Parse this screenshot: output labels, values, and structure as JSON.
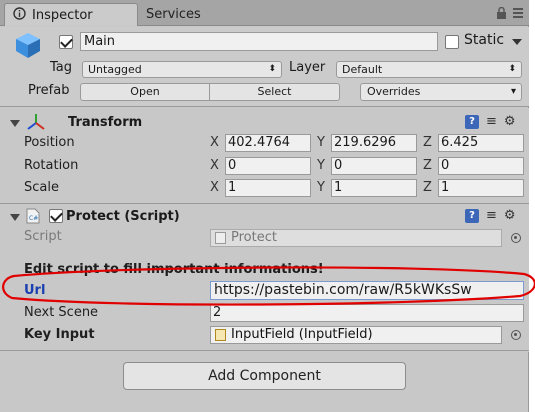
{
  "tabs": [
    {
      "label": "Inspector",
      "active": true
    },
    {
      "label": "Services",
      "active": false
    }
  ],
  "header": {
    "active_checked": true,
    "name_value": "Main",
    "static_label": "Static",
    "tag_label": "Tag",
    "tag_value": "Untagged",
    "layer_label": "Layer",
    "layer_value": "Default",
    "prefab_label": "Prefab",
    "prefab_open": "Open",
    "prefab_select": "Select",
    "prefab_overrides": "Overrides"
  },
  "transform": {
    "title": "Transform",
    "rows": [
      {
        "label": "Position",
        "x": "402.4764",
        "y": "219.6296",
        "z": "6.425"
      },
      {
        "label": "Rotation",
        "x": "0",
        "y": "0",
        "z": "0"
      },
      {
        "label": "Scale",
        "x": "1",
        "y": "1",
        "z": "1"
      }
    ],
    "axis_x": "X",
    "axis_y": "Y",
    "axis_z": "Z"
  },
  "protect": {
    "title": "Protect (Script)",
    "enabled": true,
    "script_label": "Script",
    "script_value": "Protect",
    "notice": "Edit script to fill important informations!",
    "url_label": "Url",
    "url_value": "https://pastebin.com/raw/R5kWKsSw",
    "next_scene_label": "Next Scene",
    "next_scene_value": "2",
    "key_input_label": "Key Input",
    "key_input_value": "InputField (InputField)"
  },
  "add_component_label": "Add Component",
  "colors": {
    "annotation": "#e00000",
    "url_label": "#1a3fb0",
    "transform_axis_red": "#d03020",
    "transform_axis_green": "#30a030",
    "transform_axis_blue": "#2050d0"
  }
}
